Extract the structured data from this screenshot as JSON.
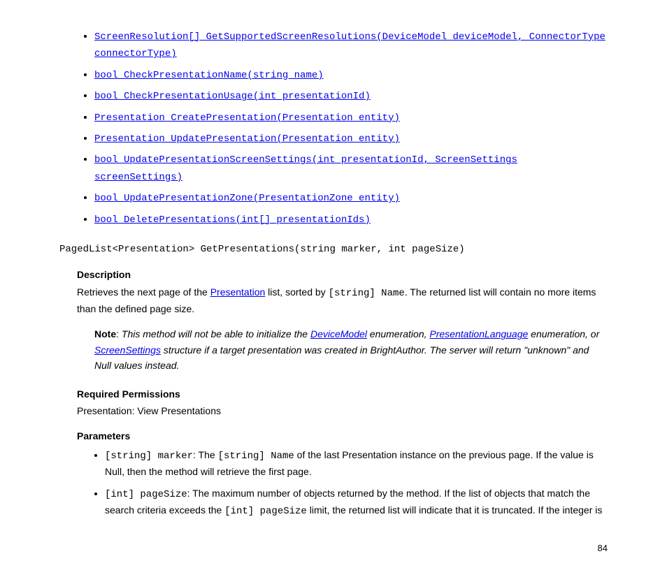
{
  "methods": [
    "ScreenResolution[] GetSupportedScreenResolutions(DeviceModel deviceModel, ConnectorType connectorType)",
    "bool CheckPresentationName(string name)",
    "bool CheckPresentationUsage(int presentationId)",
    "Presentation CreatePresentation(Presentation entity)",
    "Presentation UpdatePresentation(Presentation entity)",
    "bool UpdatePresentationScreenSettings(int presentationId, ScreenSettings screenSettings)",
    "bool UpdatePresentationZone(PresentationZone entity)",
    "bool DeletePresentations(int[] presentationIds)"
  ],
  "signature": "PagedList<Presentation> GetPresentations(string marker, int pageSize)",
  "section": {
    "desc_heading": "Description",
    "desc_prefix": "Retrieves the next page of the ",
    "desc_link": "Presentation",
    "desc_mid": " list, sorted by ",
    "desc_mono": "[string] Name",
    "desc_suffix": ". The returned list will contain no more items than the defined page size.",
    "note_label": "Note",
    "note_colon": ": ",
    "note_t1": "This method will not be able to initialize the ",
    "note_l1": "DeviceModel",
    "note_t2": " enumeration, ",
    "note_l2": "PresentationLanguage",
    "note_t3": " enumeration, or ",
    "note_l3": "ScreenSettings",
    "note_t4": " structure if a target presentation was created in BrightAuthor. The server will return \"unknown\" and Null values instead.",
    "perm_heading": "Required Permissions",
    "perm_text": "Presentation: View Presentations",
    "params_heading": "Parameters",
    "p1_mono": "[string] marker",
    "p1_t1": ": The ",
    "p1_mono2": "[string] Name",
    "p1_t2": " of the last Presentation instance on the previous page. If the value is Null, then the method will retrieve the first page.",
    "p2_mono": "[int] pageSize",
    "p2_t1": ": The maximum number of objects returned by the method. If the list of objects that match the search criteria exceeds the ",
    "p2_mono2": "[int] pageSize",
    "p2_t2": " limit, the returned list will indicate that it is truncated. If the integer is"
  },
  "page_number": "84"
}
